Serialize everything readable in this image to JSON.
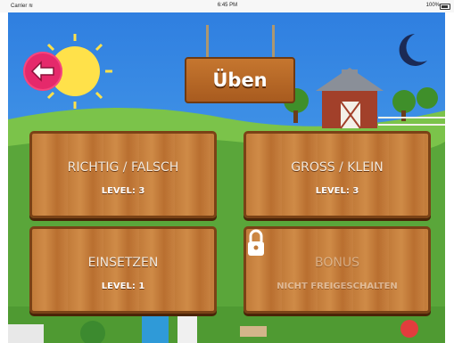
{
  "status_bar": {
    "carrier": "Carrier ≋",
    "time": "6:45 PM",
    "battery": "100%"
  },
  "header": {
    "title": "Üben",
    "back_icon": "arrow-left-icon"
  },
  "cards": [
    {
      "title": "RICHTIG / FALSCH",
      "level": "LEVEL: 3",
      "locked": false
    },
    {
      "title": "GROSS / KLEIN",
      "level": "LEVEL: 3",
      "locked": false
    },
    {
      "title": "EINSETZEN",
      "level": "LEVEL: 1",
      "locked": false
    },
    {
      "title": "BONUS",
      "level": "NICHT FREIGESCHALTEN",
      "locked": true,
      "icon": "lock-icon"
    }
  ],
  "colors": {
    "sky": "#3a8ee6",
    "grass": "#5aa63a",
    "wood": "#c27b3a",
    "back_button": "#e5296b"
  }
}
